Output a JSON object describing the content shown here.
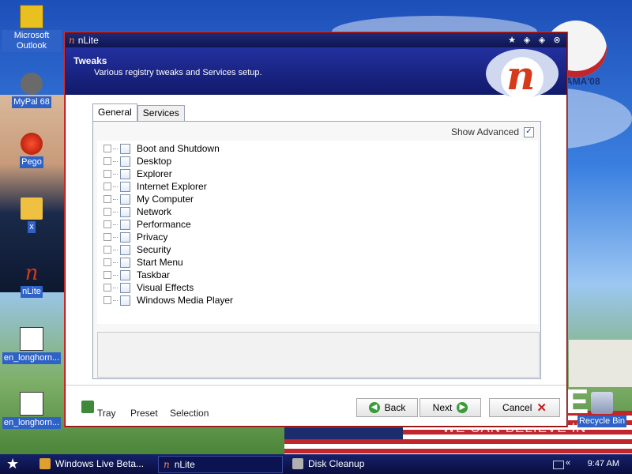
{
  "desktop": {
    "icons": [
      {
        "label": "Microsoft Outlook",
        "icon": "outlook-icon"
      },
      {
        "label": "MyPal 68",
        "icon": "mypal-icon"
      },
      {
        "label": "Pego",
        "icon": "pego-icon"
      },
      {
        "label": "x",
        "icon": "folder-icon"
      },
      {
        "label": "nLite",
        "icon": "nlite-icon"
      },
      {
        "label": "en_longhorn...",
        "icon": "disk-image-icon"
      },
      {
        "label": "en_longhorn...",
        "icon": "disk-image-icon"
      },
      {
        "label": "Recycle Bin",
        "icon": "recycle-bin-icon"
      }
    ],
    "wallpaper": {
      "logo_text": "AMA'08",
      "motto": "WE CAN BELIEVE IN",
      "big_letter": "E"
    }
  },
  "window": {
    "title": "nLite",
    "header": {
      "title": "Tweaks",
      "subtitle": "Various registry tweaks and Services setup."
    },
    "tabs": [
      {
        "label": "General",
        "active": true
      },
      {
        "label": "Services",
        "active": false
      }
    ],
    "show_advanced": {
      "label": "Show Advanced",
      "checked": true
    },
    "tree_items": [
      "Boot and Shutdown",
      "Desktop",
      "Explorer",
      "Internet Explorer",
      "My Computer",
      "Network",
      "Performance",
      "Privacy",
      "Security",
      "Start Menu",
      "Taskbar",
      "Visual Effects",
      "Windows Media Player"
    ],
    "bottom": {
      "tray_label": "Tray",
      "preset_label": "Preset",
      "selection_label": "Selection",
      "back_label": "Back",
      "next_label": "Next",
      "cancel_label": "Cancel"
    }
  },
  "taskbar": {
    "items": [
      {
        "label": "Windows Live Beta...",
        "active": false
      },
      {
        "label": "nLite",
        "active": true
      },
      {
        "label": "Disk Cleanup",
        "active": false
      }
    ],
    "tray_symbol": "«",
    "clock": "9:47 AM"
  },
  "colors": {
    "title_bar": "#1e2a78",
    "header": "#2430a0",
    "accent_red": "#c41c1c",
    "nav_green": "#3a9b3a"
  }
}
